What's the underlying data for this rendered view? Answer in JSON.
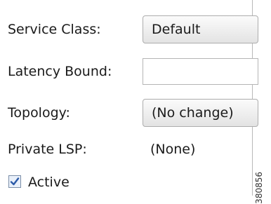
{
  "form": {
    "service_class": {
      "label": "Service Class:",
      "value": "Default"
    },
    "latency_bound": {
      "label": "Latency Bound:",
      "value": ""
    },
    "topology": {
      "label": "Topology:",
      "value": "(No change)"
    },
    "private_lsp": {
      "label": "Private LSP:",
      "value": "(None)"
    },
    "active": {
      "label": "Active",
      "checked": true
    }
  },
  "figure_id": "380856",
  "colors": {
    "checkmark": "#2b5aa8",
    "checkbox_fill": "#e9f0fa"
  }
}
